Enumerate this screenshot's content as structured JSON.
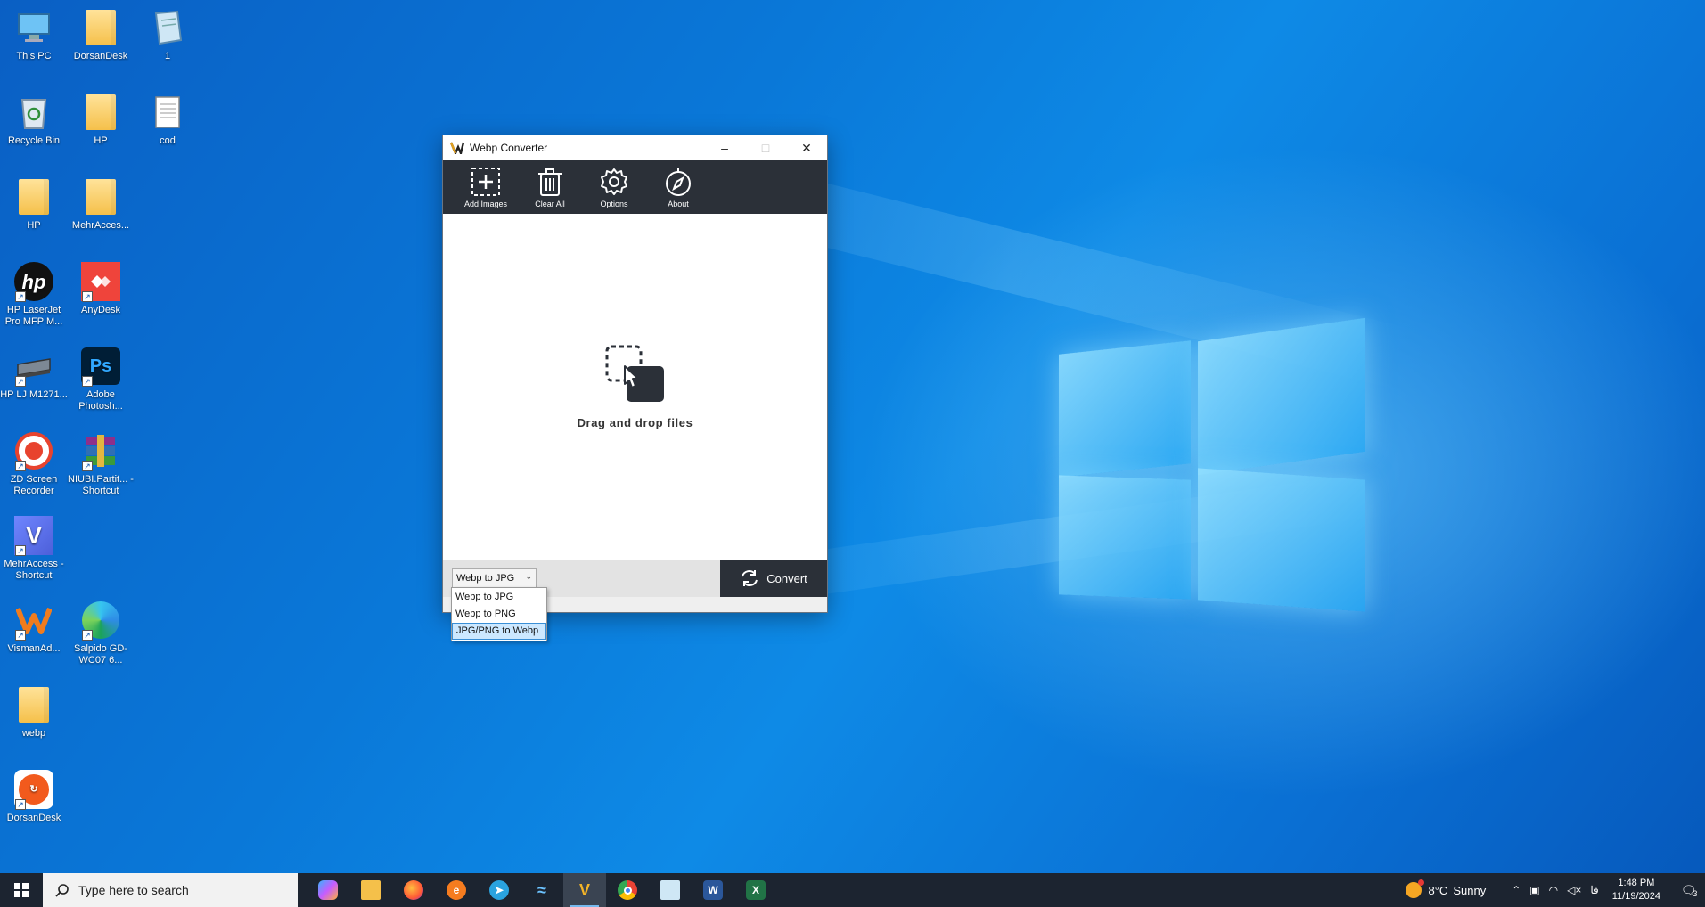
{
  "desktop": {
    "icons": [
      {
        "label": "This PC"
      },
      {
        "label": "DorsanDesk"
      },
      {
        "label": "1"
      },
      {
        "label": "Recycle Bin"
      },
      {
        "label": "HP"
      },
      {
        "label": "cod"
      },
      {
        "label": "HP"
      },
      {
        "label": "MehrAcces..."
      },
      {
        "label": "HP LaserJet Pro MFP M..."
      },
      {
        "label": "AnyDesk"
      },
      {
        "label": "HP LJ M1271..."
      },
      {
        "label": "Adobe Photosh..."
      },
      {
        "label": "ZD Screen Recorder"
      },
      {
        "label": "NIUBI.Partit... - Shortcut"
      },
      {
        "label": "MehrAccess - Shortcut"
      },
      {
        "label": "VismanAd..."
      },
      {
        "label": "Salpido GD-WC07 6..."
      },
      {
        "label": "webp"
      },
      {
        "label": "DorsanDesk"
      }
    ]
  },
  "app": {
    "title": "Webp Converter",
    "toolbar": {
      "add": "Add Images",
      "clear": "Clear All",
      "options": "Options",
      "about": "About"
    },
    "dropzone_text": "Drag and drop files",
    "format_select": {
      "selected": "Webp to JPG",
      "options": [
        "Webp to JPG",
        "Webp to PNG",
        "JPG/PNG to Webp"
      ],
      "highlighted": "JPG/PNG to Webp"
    },
    "convert_label": "Convert",
    "colors": {
      "toolbar_bg": "#2b3038",
      "accent": "#76b9ed"
    }
  },
  "taskbar": {
    "search_placeholder": "Type here to search",
    "weather": {
      "temp": "8°C",
      "condition": "Sunny"
    },
    "lang": "فا",
    "time": "1:48 PM",
    "date": "11/19/2024",
    "notifications": "3",
    "apps": [
      "copilot-icon",
      "file-explorer-icon",
      "firefox-icon",
      "app-orange-icon",
      "telegram-icon",
      "app-wave-icon",
      "webp-converter-icon",
      "chrome-icon",
      "notepad-icon",
      "word-icon",
      "excel-icon"
    ]
  }
}
